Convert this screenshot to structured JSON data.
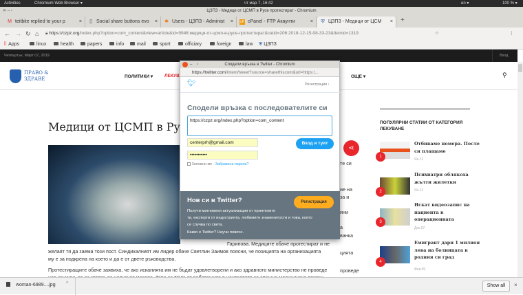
{
  "os": {
    "activities": "Activities",
    "app": "Chromium Web Browser ▾",
    "clock": "чт мар  7, 16:42",
    "lang": "en ▾",
    "battery": "100 % ▾"
  },
  "window": {
    "title": "ЦЗПЗ - Медици от ЦСМП в Русе протестират - Chromium"
  },
  "tabs": [
    {
      "label": "teitbite replied to your p",
      "icon": "gmail-icon"
    },
    {
      "label": "Social share buttons evo",
      "icon": "page-icon"
    },
    {
      "label": "Users - ЦЗПЗ - Administ",
      "icon": "joomla-icon"
    },
    {
      "label": "cPanel - FTP Акаунти",
      "icon": "cpanel-icon"
    },
    {
      "label": "ЦЗПЗ - Медици от ЦСМ",
      "icon": "shield-icon"
    }
  ],
  "address": {
    "host": "https://czpz.org",
    "path": "/index.php?option=com_content&view=article&id=9946:медици-от-цсмп-в-русе-протестират&catid=206:2018-12-15-08-33-23&Itemid=1319"
  },
  "bookmarks": [
    "Apps",
    "linux",
    "health",
    "papers",
    "info",
    "mail",
    "sport",
    "officiary",
    "foreign",
    "law",
    "ЦЗПЗ"
  ],
  "site": {
    "date": "Четвъртък, Март 07, 2019",
    "login": "Вход",
    "logo_line1": "ПРАВО &",
    "logo_line2": "ЗДРАВЕ",
    "nav": [
      "ПОЛИТИКИ ▾",
      "ЛЕКУВ",
      "ОЩЕ ▾"
    ],
    "article_title": "Медици от ЦСМП в Рус",
    "fragments": [
      "те си",
      "ие на",
      "за и",
      "ини",
      "а",
      "ванка",
      "цията",
      "проведе"
    ],
    "para_hidden": "Гарипова. Медиците обаче протестират и не",
    "para1a": "желаят тя да заема този пост. Синдикалният им лидер обаче Светлин Заимов поясни, че позицията на организацията",
    "para1b": "му е за подкрепа на което и да е от двете ръководства.",
    "para2a": "Протестиращите обаче заявиха, че ако исканията им не бъдат удовлетворени и ако здравното министерство не проведе",
    "para2b": "нов конкурс, те са готови да напуснат масово. Това са 60 % от работещите в центровете за спешна медицинска помощ"
  },
  "sidebar": {
    "heading1": "ПОПУЛЯРНИ СТАТИИ ОТ КАТЕГОРИЯ",
    "heading2": "ЛЕКУВАНЕ",
    "items": [
      {
        "n": "1",
        "title": "Отбиваме номера. После си плащаме",
        "date": "Ян.12"
      },
      {
        "n": "2",
        "title": "Психиатри облякоха жълти жилетки",
        "date": "Ян.11"
      },
      {
        "n": "3",
        "title": "Искат видеозапис на пациента в операционната",
        "date": "Дек.07"
      },
      {
        "n": "4",
        "title": "Емигрант дари 1 милион лева на болницата в родния си град",
        "date": "Фев.09"
      }
    ]
  },
  "popup": {
    "title": "Сподели връзка в Twitter - Chromium",
    "url_host": "https://twitter.com",
    "url_path": "/intent/tweet?source=sharethiscom&url=https:/...",
    "signup_link": "Регистрация ›",
    "heading": "Сподели връзка с последователите си",
    "tweet_text": "https://czpz.org/index.php?option=com_content",
    "email": "centerprh@gmail.com",
    "password": "•••••••••••",
    "login_btn": "Вход и туит",
    "remember": "Запомни ме",
    "sep": "·",
    "forgot": "Забравена парола?",
    "new_heading": "Нов си в Twitter?",
    "signup_btn": "Регистрация",
    "new_text1": "Получи мигновени актуализации от приятелите",
    "new_text2": "ти, експерти от индустрията, любимите знаменитости и това, което",
    "new_text3": "се случва по света.",
    "learn": "Какво е Twitter? Научи повече."
  },
  "download": {
    "file": "woman-6989....jpg",
    "show_all": "Show all"
  },
  "colors": {
    "accent_red": "#e8262c",
    "twitter_blue": "#1da1f2",
    "signup_yellow": "#ffad1f"
  }
}
